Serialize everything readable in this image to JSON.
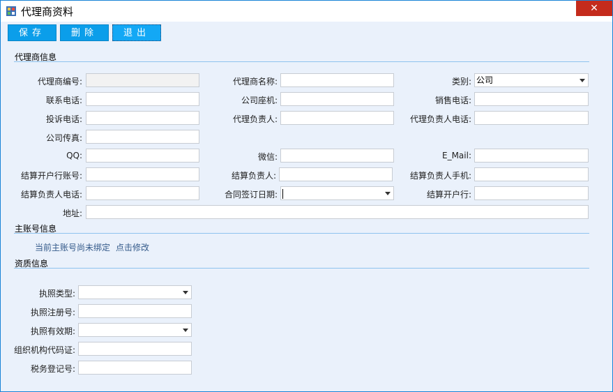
{
  "window": {
    "title": "代理商资料",
    "close_label": "✕"
  },
  "toolbar": {
    "save_label": "保存",
    "delete_label": "删除",
    "exit_label": "退出"
  },
  "sections": {
    "agent_info": "代理商信息",
    "main_account": "主账号信息",
    "qualification": "资质信息"
  },
  "agent": {
    "agent_no_label": "代理商编号:",
    "agent_name_label": "代理商名称:",
    "category_label": "类别:",
    "category_value": "公司",
    "contact_phone_label": "联系电话:",
    "company_phone_label": "公司座机:",
    "sales_phone_label": "销售电话:",
    "complaint_phone_label": "投诉电话:",
    "agent_manager_label": "代理负责人:",
    "agent_manager_phone_label": "代理负责人电话:",
    "company_fax_label": "公司传真:",
    "qq_label": "QQ:",
    "wechat_label": "微信:",
    "email_label": "E_Mail:",
    "settle_account_label": "结算开户行账号:",
    "settle_manager_label": "结算负责人:",
    "settle_manager_mobile_label": "结算负责人手机:",
    "settle_manager_phone_label": "结算负责人电话:",
    "contract_date_label": "合同签订日期:",
    "settle_bank_label": "结算开户行:",
    "address_label": "地址:"
  },
  "main_account": {
    "status_text": "当前主账号尚未绑定",
    "edit_link": "点击修改"
  },
  "qualification": {
    "license_type_label": "执照类型:",
    "license_reg_no_label": "执照注册号:",
    "license_valid_label": "执照有效期:",
    "org_code_label": "组织机构代码证:",
    "tax_reg_label": "税务登记号:"
  }
}
